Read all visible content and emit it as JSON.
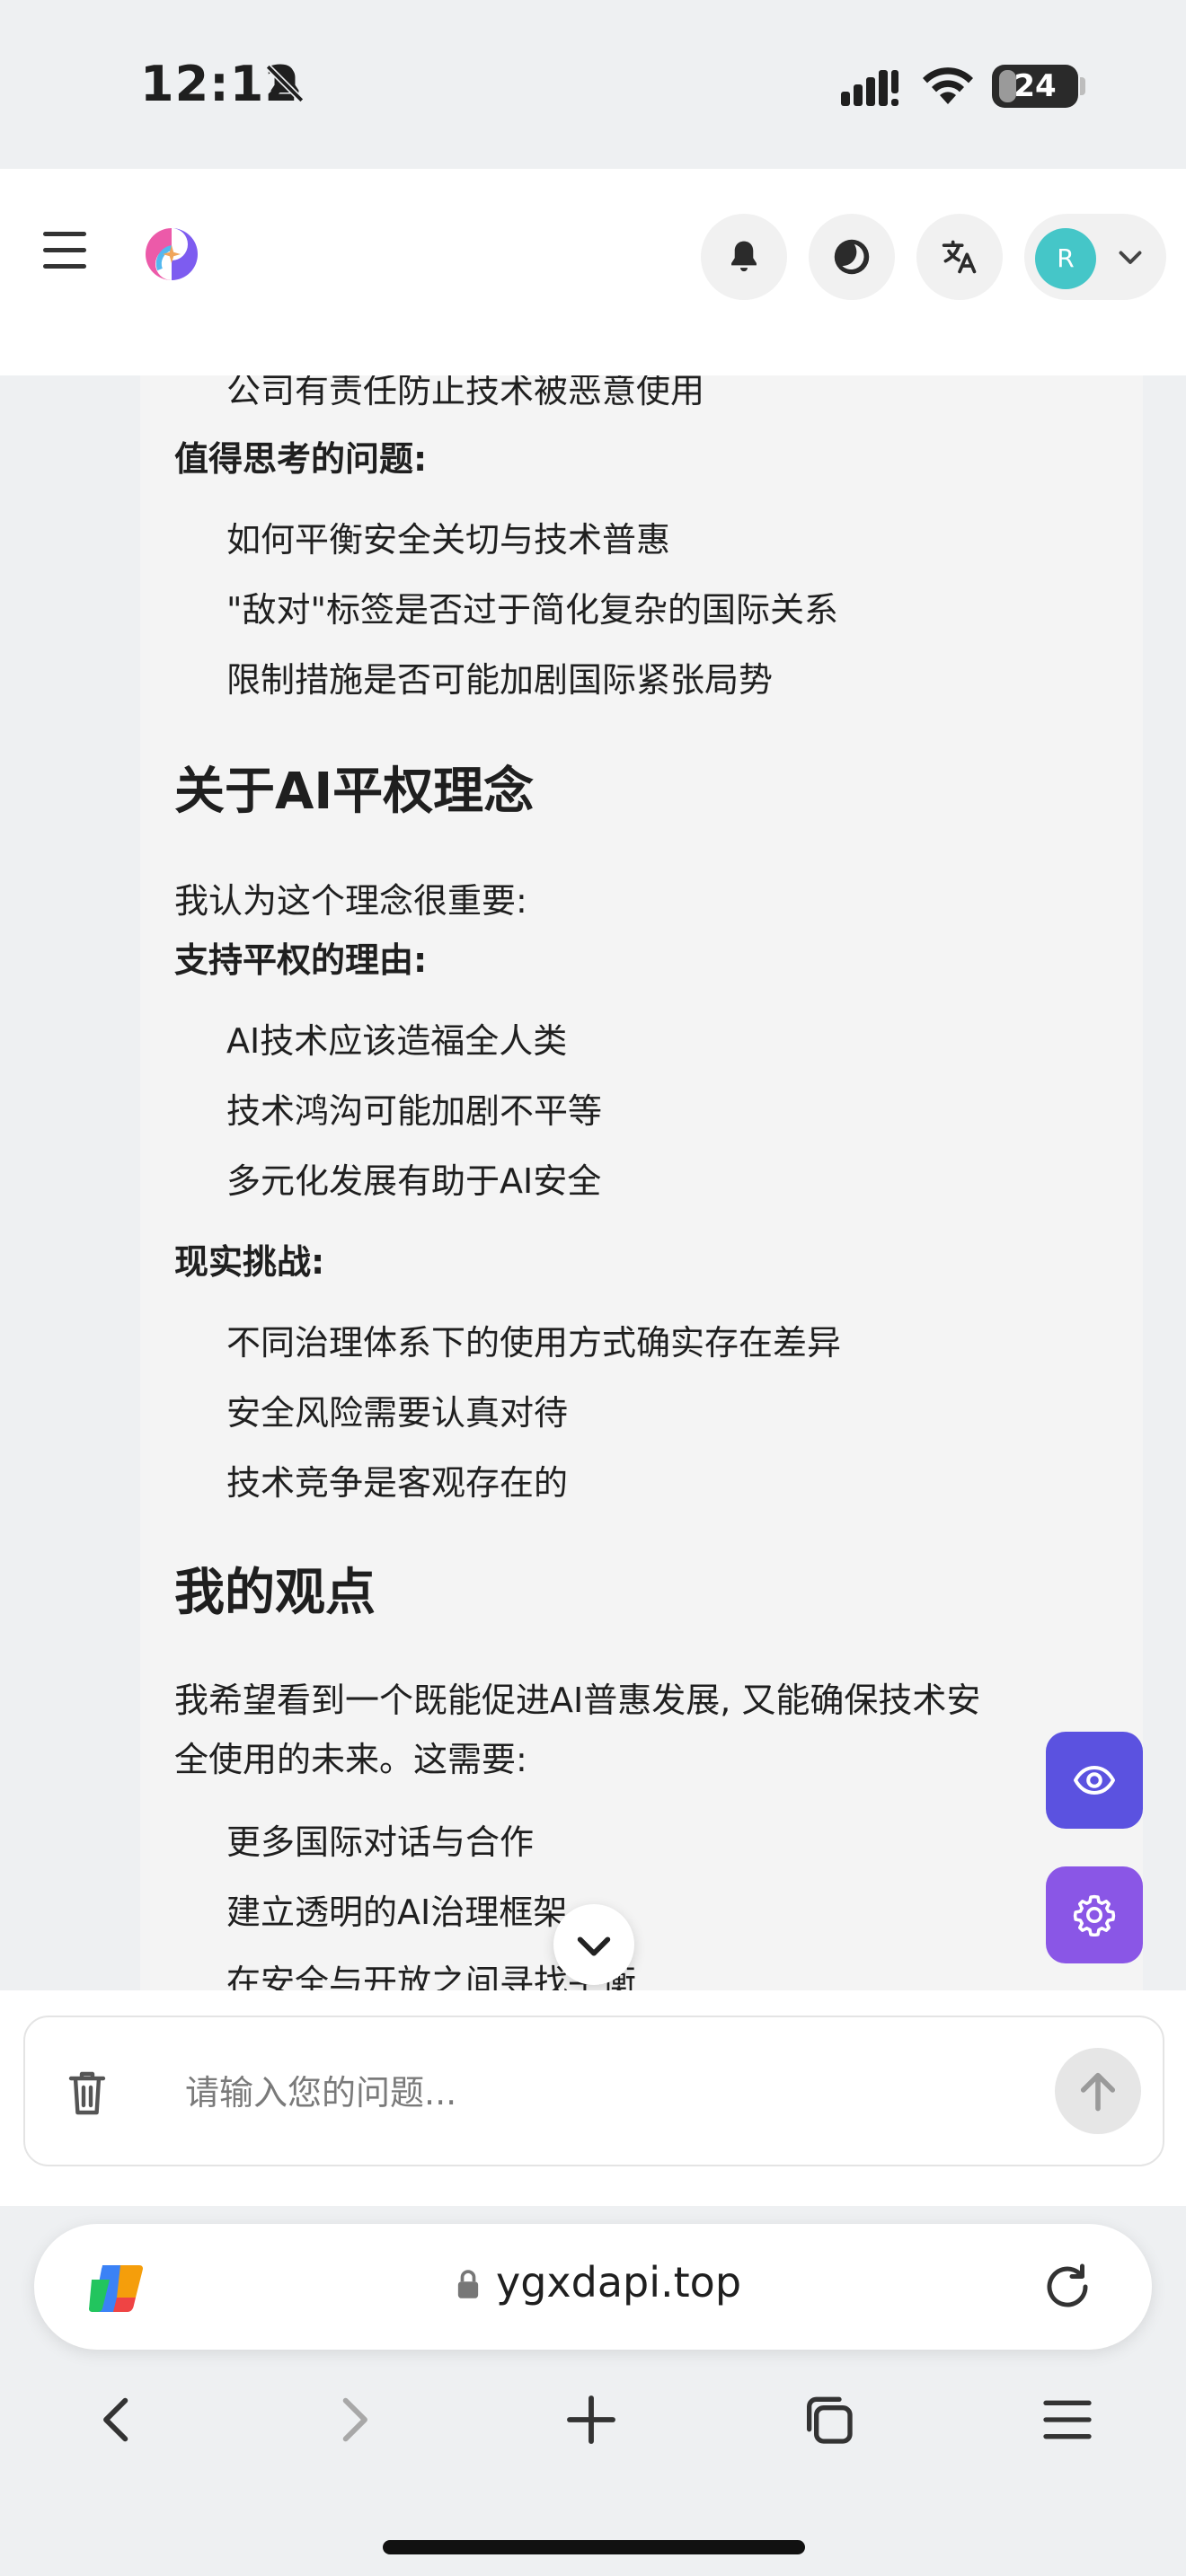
{
  "status_bar": {
    "time": "12:12",
    "battery": "24",
    "battery_fraction": 0.24
  },
  "header": {
    "avatar_initial": "R"
  },
  "message": {
    "cut_top_line": "公司有责任防止技术被恶意使用",
    "section1": {
      "subheading": "值得思考的问题:",
      "items": [
        "如何平衡安全关切与技术普惠",
        "\"敌对\"标签是否过于简化复杂的国际关系",
        "限制措施是否可能加剧国际紧张局势"
      ]
    },
    "section2": {
      "heading": "关于AI平权理念",
      "intro": "我认为这个理念很重要:",
      "support_heading": "支持平权的理由:",
      "support_items": [
        "AI技术应该造福全人类",
        "技术鸿沟可能加剧不平等",
        "多元化发展有助于AI安全"
      ],
      "challenge_heading": "现实挑战:",
      "challenge_items": [
        "不同治理体系下的使用方式确实存在差异",
        "安全风险需要认真对待",
        "技术竞争是客观存在的"
      ]
    },
    "section3": {
      "heading": "我的观点",
      "para_line1": "我希望看到一个既能促进AI普惠发展, 又能确保技术安",
      "para_line2": "全使用的未来。这需要:",
      "items": [
        "更多国际对话与合作",
        "建立透明的AI治理框架",
        "在安全与开放之间寻找平衡"
      ]
    }
  },
  "input": {
    "placeholder": "请输入您的问题..."
  },
  "browser": {
    "url": "ygxdapi.top"
  },
  "colors": {
    "fab_eye": "#5b52e0",
    "fab_gear": "#8a56e6",
    "avatar": "#45c6c8"
  },
  "icons": [
    "menu-icon",
    "logo-icon",
    "bell-icon",
    "moon-icon",
    "translate-icon",
    "chevron-down-icon",
    "eye-icon",
    "gear-icon",
    "trash-icon",
    "send-arrow-icon",
    "copilot-icon",
    "lock-icon",
    "reload-icon",
    "back-icon",
    "forward-icon",
    "new-tab-icon",
    "tabs-icon",
    "browser-menu-icon"
  ]
}
